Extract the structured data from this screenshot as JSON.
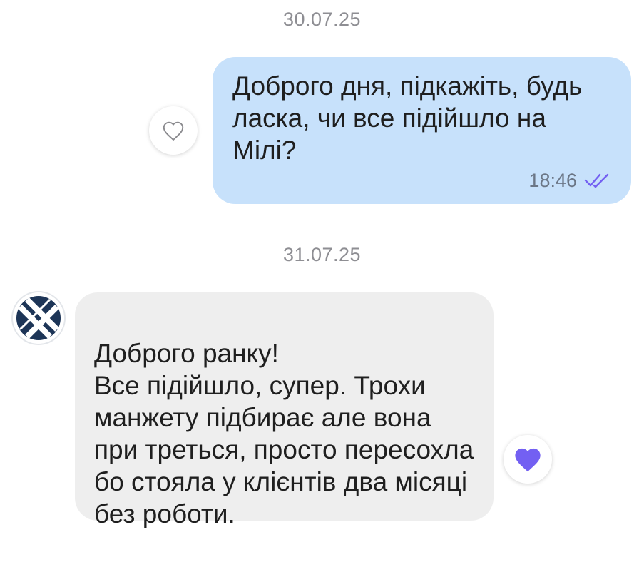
{
  "chat": {
    "date_1": "30.07.25",
    "date_2": "31.07.25",
    "outgoing": {
      "text": "Доброго дня, підкажіть, будь ласка, чи все підійшло на Мілі?",
      "time": "18:46",
      "status_icon": "double-check-icon",
      "reaction_icon": "heart-outline-icon"
    },
    "incoming": {
      "text": "Доброго ранку!\nВсе підійшло, супер. Трохи манжету підбирає але вона при треться, просто пересохла бо стояла у клієнтів два місяці без роботи.",
      "reaction_icon": "heart-filled-icon",
      "avatar_icon": "brand-logo-icon"
    }
  },
  "colors": {
    "outgoing_bubble": "#c7e1fb",
    "incoming_bubble": "#eeeeee",
    "accent_purple": "#7360f2",
    "logo_navy": "#1d3557"
  }
}
